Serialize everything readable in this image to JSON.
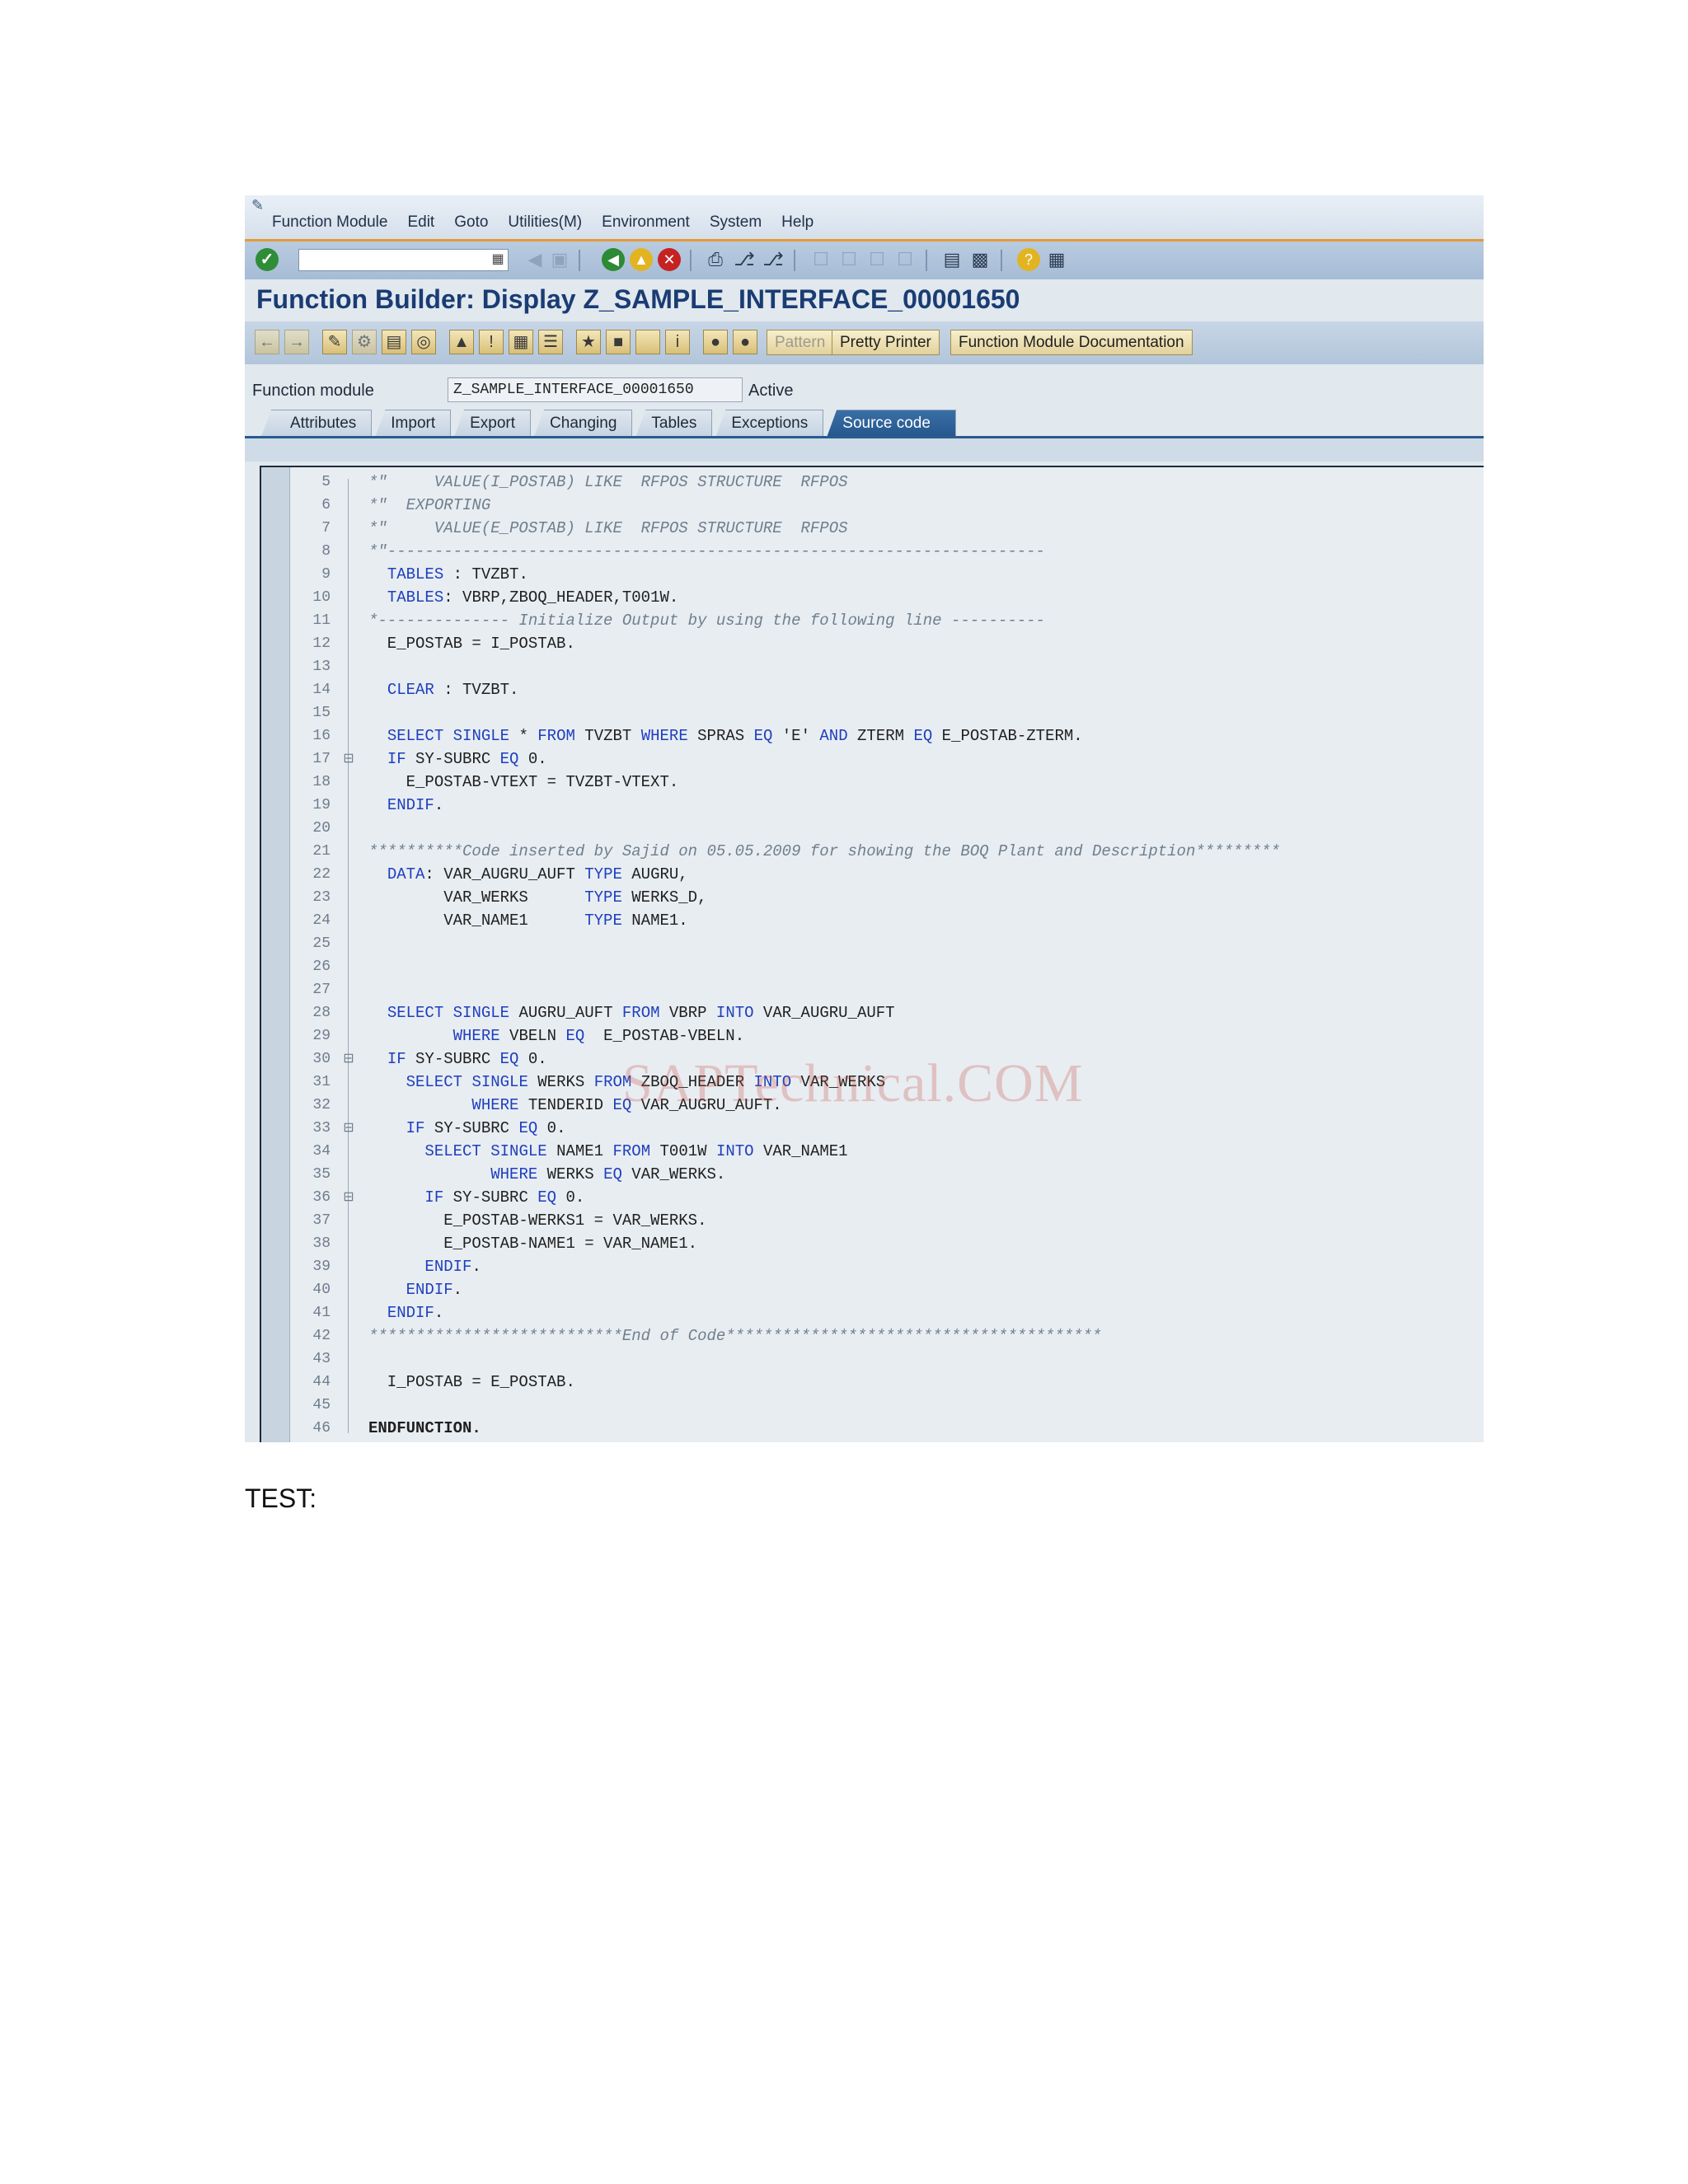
{
  "menu": {
    "items": [
      "Function Module",
      "Edit",
      "Goto",
      "Utilities(M)",
      "Environment",
      "System",
      "Help"
    ]
  },
  "standard_toolbar": {
    "command_field": "",
    "icons": [
      "enter-icon",
      "back-icon",
      "save-icon",
      "back-icon",
      "exit-icon",
      "cancel-icon",
      "print-icon",
      "find-icon",
      "find-next-icon",
      "first-page-icon",
      "prev-page-icon",
      "next-page-icon",
      "last-page-icon",
      "create-session-icon",
      "shortcut-icon",
      "help-icon",
      "layout-icon"
    ]
  },
  "title": "Function Builder: Display Z_SAMPLE_INTERFACE_00001650",
  "app_toolbar": {
    "buttons": [
      "Pattern",
      "Pretty Printer",
      "Function Module Documentation"
    ]
  },
  "function_module": {
    "label": "Function module",
    "value": "Z_SAMPLE_INTERFACE_00001650",
    "status": "Active"
  },
  "tabs": [
    "Attributes",
    "Import",
    "Export",
    "Changing",
    "Tables",
    "Exceptions",
    "Source code"
  ],
  "active_tab": "Source code",
  "code_lines": [
    {
      "n": "5",
      "text": "*\"     VALUE(I_POSTAB) LIKE  RFPOS STRUCTURE  RFPOS",
      "type": "comment"
    },
    {
      "n": "6",
      "text": "*\"  EXPORTING",
      "type": "comment"
    },
    {
      "n": "7",
      "text": "*\"     VALUE(E_POSTAB) LIKE  RFPOS STRUCTURE  RFPOS",
      "type": "comment"
    },
    {
      "n": "8",
      "text": "*\"----------------------------------------------------------------------",
      "type": "comment"
    },
    {
      "n": "9",
      "text": "  TABLES : TVZBT.",
      "type": "code"
    },
    {
      "n": "10",
      "text": "  TABLES: VBRP,ZBOQ_HEADER,T001W.",
      "type": "code"
    },
    {
      "n": "11",
      "text": "*-------------- Initialize Output by using the following line ----------",
      "type": "comment"
    },
    {
      "n": "12",
      "text": "  E_POSTAB = I_POSTAB.",
      "type": "code"
    },
    {
      "n": "13",
      "text": "",
      "type": "code"
    },
    {
      "n": "14",
      "text": "  CLEAR : TVZBT.",
      "type": "code"
    },
    {
      "n": "15",
      "text": "",
      "type": "code"
    },
    {
      "n": "16",
      "text": "  SELECT SINGLE * FROM TVZBT WHERE SPRAS EQ 'E' AND ZTERM EQ E_POSTAB-ZTERM.",
      "type": "code"
    },
    {
      "n": "17",
      "text": "  IF SY-SUBRC EQ 0.",
      "type": "code"
    },
    {
      "n": "18",
      "text": "    E_POSTAB-VTEXT = TVZBT-VTEXT.",
      "type": "code"
    },
    {
      "n": "19",
      "text": "  ENDIF.",
      "type": "code"
    },
    {
      "n": "20",
      "text": "",
      "type": "code"
    },
    {
      "n": "21",
      "text": "**********Code inserted by Sajid on 05.05.2009 for showing the BOQ Plant and Description*********",
      "type": "comment"
    },
    {
      "n": "22",
      "text": "  DATA: VAR_AUGRU_AUFT TYPE AUGRU,",
      "type": "code"
    },
    {
      "n": "23",
      "text": "        VAR_WERKS      TYPE WERKS_D,",
      "type": "code"
    },
    {
      "n": "24",
      "text": "        VAR_NAME1      TYPE NAME1.",
      "type": "code"
    },
    {
      "n": "25",
      "text": "",
      "type": "code"
    },
    {
      "n": "26",
      "text": "",
      "type": "code"
    },
    {
      "n": "27",
      "text": "",
      "type": "code"
    },
    {
      "n": "28",
      "text": "  SELECT SINGLE AUGRU_AUFT FROM VBRP INTO VAR_AUGRU_AUFT",
      "type": "code"
    },
    {
      "n": "29",
      "text": "         WHERE VBELN EQ  E_POSTAB-VBELN.",
      "type": "code"
    },
    {
      "n": "30",
      "text": "  IF SY-SUBRC EQ 0.",
      "type": "code"
    },
    {
      "n": "31",
      "text": "    SELECT SINGLE WERKS FROM ZBOQ_HEADER INTO VAR_WERKS",
      "type": "code"
    },
    {
      "n": "32",
      "text": "           WHERE TENDERID EQ VAR_AUGRU_AUFT.",
      "type": "code"
    },
    {
      "n": "33",
      "text": "    IF SY-SUBRC EQ 0.",
      "type": "code"
    },
    {
      "n": "34",
      "text": "      SELECT SINGLE NAME1 FROM T001W INTO VAR_NAME1",
      "type": "code"
    },
    {
      "n": "35",
      "text": "             WHERE WERKS EQ VAR_WERKS.",
      "type": "code"
    },
    {
      "n": "36",
      "text": "      IF SY-SUBRC EQ 0.",
      "type": "code"
    },
    {
      "n": "37",
      "text": "        E_POSTAB-WERKS1 = VAR_WERKS.",
      "type": "code"
    },
    {
      "n": "38",
      "text": "        E_POSTAB-NAME1 = VAR_NAME1.",
      "type": "code"
    },
    {
      "n": "39",
      "text": "      ENDIF.",
      "type": "code"
    },
    {
      "n": "40",
      "text": "    ENDIF.",
      "type": "code"
    },
    {
      "n": "41",
      "text": "  ENDIF.",
      "type": "code"
    },
    {
      "n": "42",
      "text": "***************************End of Code****************************************",
      "type": "comment"
    },
    {
      "n": "43",
      "text": "",
      "type": "code"
    },
    {
      "n": "44",
      "text": "  I_POSTAB = E_POSTAB.",
      "type": "code"
    },
    {
      "n": "45",
      "text": "",
      "type": "code"
    },
    {
      "n": "46",
      "text": "ENDFUNCTION.",
      "type": "bold"
    }
  ],
  "fold_markers": [
    "17",
    "30",
    "33",
    "36"
  ],
  "watermark": "SAPTechnical.COM",
  "below_text": "TEST:",
  "colors": {
    "title": "#1a3c74",
    "keyword": "#1e3fbf",
    "comment": "#6f7f8e",
    "active_tab": "#2a5b8f",
    "menu_accent": "#e59a38"
  }
}
